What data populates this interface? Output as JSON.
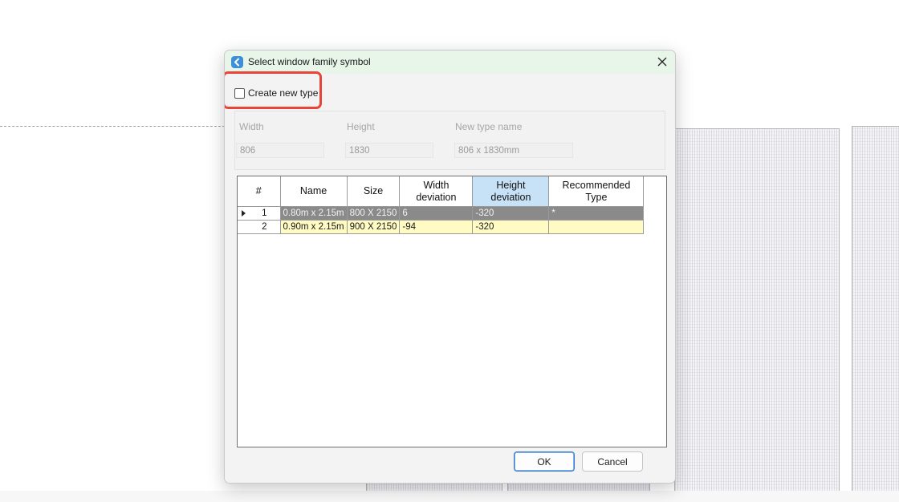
{
  "dialog": {
    "title": "Select window family symbol",
    "create_new_type_label": "Create new type",
    "create_new_type_checked": false
  },
  "fields": {
    "width_label": "Width",
    "height_label": "Height",
    "new_type_name_label": "New type name",
    "width_value": "806",
    "height_value": "1830",
    "new_type_name_value": "806 x 1830mm"
  },
  "table": {
    "headers": {
      "num": "#",
      "name": "Name",
      "size": "Size",
      "width_dev_1": "Width",
      "width_dev_2": "deviation",
      "height_dev_1": "Height",
      "height_dev_2": "deviation",
      "rec_1": "Recommended",
      "rec_2": "Type"
    },
    "rows": [
      {
        "num": "1",
        "name": "0.80m x 2.15m",
        "size": "800 X 2150",
        "width_dev": "6",
        "height_dev": "-320",
        "recommended": "*"
      },
      {
        "num": "2",
        "name": "0.90m x 2.15m",
        "size": "900 X 2150",
        "width_dev": "-94",
        "height_dev": "-320",
        "recommended": ""
      }
    ]
  },
  "buttons": {
    "ok": "OK",
    "cancel": "Cancel"
  },
  "colors": {
    "highlight": "#e8443a",
    "selected_row": "#8a8a8a",
    "yellow_row": "#fffbc3",
    "selected_header": "#c7e1f6"
  }
}
